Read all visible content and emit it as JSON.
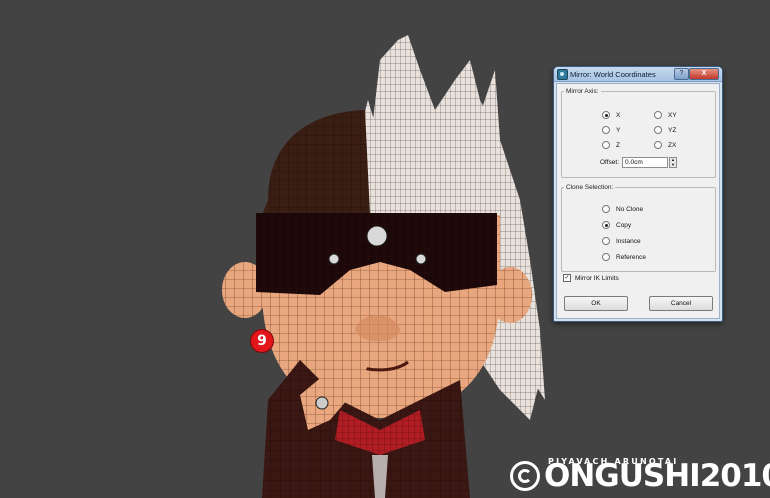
{
  "step_badge": "9",
  "dialog": {
    "title": "Mirror: World Coordinates",
    "help_label": "?",
    "close_label": "X",
    "mirror_axis": {
      "legend": "Mirror Axis:",
      "options": [
        "X",
        "Y",
        "Z",
        "XY",
        "YZ",
        "ZX"
      ],
      "selected": "X",
      "offset_label": "Offset:",
      "offset_value": "0.0cm"
    },
    "clone_selection": {
      "legend": "Clone Selection:",
      "options": [
        "No Clone",
        "Copy",
        "Instance",
        "Reference"
      ],
      "selected": "Copy"
    },
    "mirror_ik_limits": {
      "label": "Mirror IK Limits",
      "checked": true
    },
    "ok_label": "OK",
    "cancel_label": "Cancel"
  },
  "watermark": {
    "author": "PIYAVACH ARUNOTAI",
    "logo_text": "ONGUSHI2010"
  }
}
